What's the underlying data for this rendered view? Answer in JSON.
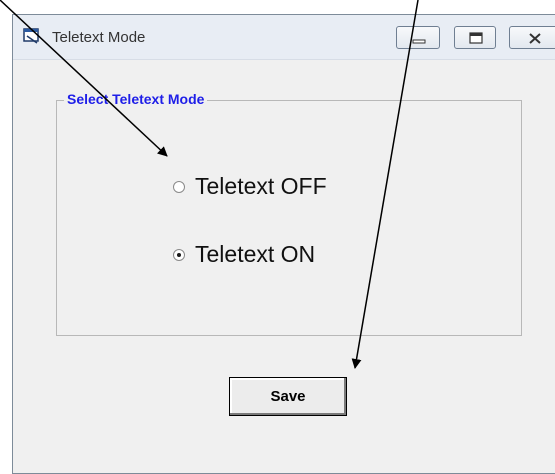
{
  "window": {
    "title": "Teletext Mode"
  },
  "group": {
    "legend": "Select Teletext Mode",
    "legend_color": "#1e1ee8"
  },
  "options": [
    {
      "label": "Teletext OFF",
      "checked": false
    },
    {
      "label": "Teletext ON",
      "checked": true
    }
  ],
  "save_label": "Save",
  "icons": {
    "app": "window-icon",
    "minimize": "minimize-icon",
    "maximize": "maximize-icon",
    "close": "close-icon"
  }
}
